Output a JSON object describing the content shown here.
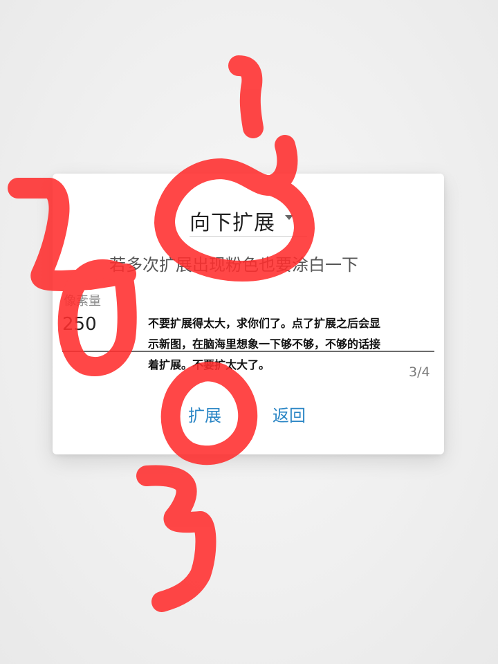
{
  "dialog": {
    "dropdown_label": "向下扩展",
    "hint": "若多次扩展出现粉色也要涂白一下",
    "pixel_field": {
      "label": "像素量",
      "value": "250"
    },
    "note": "不要扩展得太大，求你们了。点了扩展之后会显示新图，在脑海里想象一下够不够，不够的话接着扩展。不要扩太大了。",
    "counter": "3/4",
    "buttons": {
      "expand": "扩展",
      "back": "返回"
    }
  },
  "annotations": {
    "numerals": [
      "1",
      "2",
      "3"
    ],
    "ink_color": "#ff2e2e"
  },
  "colors": {
    "accent": "#2b86c5"
  }
}
